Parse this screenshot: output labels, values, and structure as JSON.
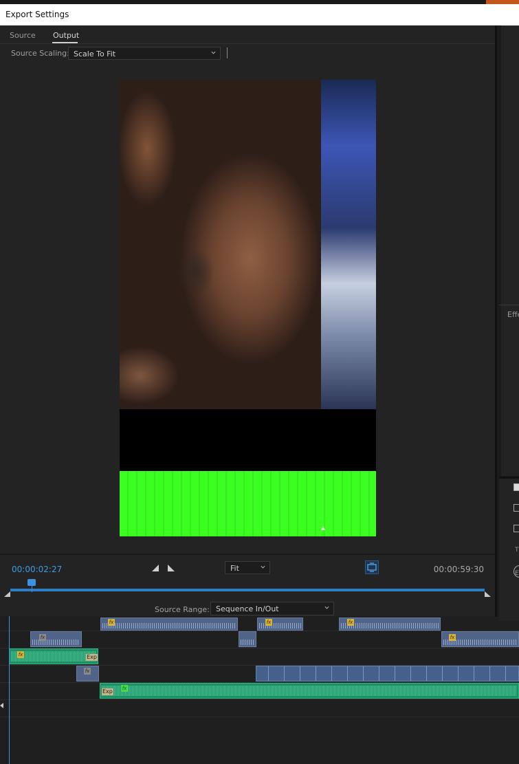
{
  "window": {
    "title": "Export Settings"
  },
  "tabs": [
    {
      "label": "Source"
    },
    {
      "label": "Output"
    }
  ],
  "scaling": {
    "label": "Source Scaling:",
    "value": "Scale To Fit"
  },
  "playback": {
    "current_time": "00:00:02:27",
    "end_time": "00:00:59:30",
    "zoom": "Fit",
    "progress_fraction": 0.045
  },
  "range": {
    "label": "Source Range:",
    "value": "Sequence In/Out"
  },
  "timeline": {
    "fx_label": "fx",
    "exp_label": "Exp"
  },
  "right_panel": {
    "effects_label": "Effe",
    "letter_t": "T",
    "letter_e": "E"
  },
  "colors": {
    "accent_blue": "#3e9be0",
    "video_clip": "#4f6488",
    "audio_clip": "#1f8f66",
    "green_screen": "#3bff1f"
  }
}
